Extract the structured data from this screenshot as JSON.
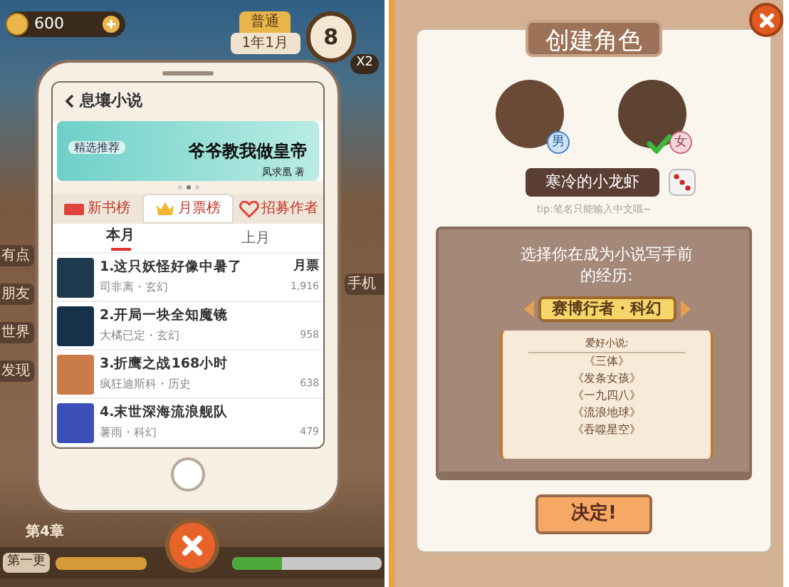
{
  "game_screen": {
    "hud": {
      "coins": "600",
      "mode": "普通",
      "date": "1年1月",
      "day": "8",
      "multiplier": "X2"
    },
    "side_menu_left": [
      "有点",
      "朋友",
      "世界",
      "发现"
    ],
    "side_menu_right": [
      "手机"
    ],
    "phone": {
      "app_title": "息壤小说",
      "banner": {
        "badge": "精选推荐",
        "title": "爷爷教我做皇帝",
        "author": "凤求凰 著"
      },
      "tabs": [
        {
          "label": "新书榜",
          "kind": "new",
          "selected": false
        },
        {
          "label": "月票榜",
          "kind": "crown",
          "selected": true
        },
        {
          "label": "招募作者",
          "kind": "handshake",
          "selected": false
        }
      ],
      "subtabs": [
        {
          "label": "本月",
          "selected": true
        },
        {
          "label": "上月",
          "selected": false
        }
      ],
      "column_label": "月票",
      "books": [
        {
          "title": "1.这只妖怪好像中暑了",
          "meta": "司非离・玄幻",
          "votes": "1,916",
          "color": "#1f3a4f"
        },
        {
          "title": "2.开局一块全知魔镜",
          "meta": "大橘已定・玄幻",
          "votes": "958",
          "color": "#16324a"
        },
        {
          "title": "3.折鹰之战168小时",
          "meta": "疯狂迪斯科・历史",
          "votes": "638",
          "color": "#c97b4a"
        },
        {
          "title": "4.末世深海流浪舰队",
          "meta": "薯雨・科幻",
          "votes": "479",
          "color": "#3a4fb8"
        }
      ]
    },
    "chapter": "第4章",
    "update_label": "第一更",
    "progress": {
      "level": 0.33
    }
  },
  "create_character": {
    "title": "创建角色",
    "genders": [
      {
        "label": "男",
        "selected": false
      },
      {
        "label": "女",
        "selected": true
      }
    ],
    "name": "寒冷的小龙虾",
    "tip": "tip:笔名只能输入中文哦~",
    "question": "选择你在成为小说写手前的经历:",
    "experience": "赛博行者・科幻",
    "favorites_label": "爱好小说:",
    "favorites": [
      "《三体》",
      "《发条女孩》",
      "《一九四八》",
      "《流浪地球》",
      "《吞噬星空》"
    ],
    "confirm": "决定!"
  }
}
